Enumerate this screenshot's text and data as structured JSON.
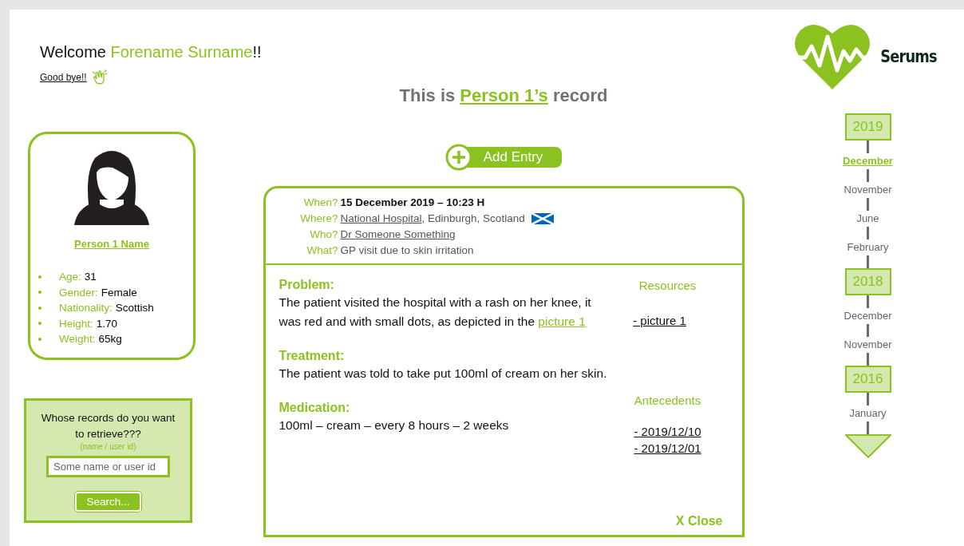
{
  "welcome": {
    "greeting": "Welcome ",
    "user_name": "Forename Surname",
    "suffix": "!!"
  },
  "logout": {
    "label": "Good bye!!"
  },
  "title": {
    "prefix": "This is ",
    "person_link": "Person 1’s",
    "suffix": " record"
  },
  "profile": {
    "name": "Person 1 Name",
    "attributes": [
      {
        "label": "Age:",
        "value": "31"
      },
      {
        "label": "Gender:",
        "value": "Female"
      },
      {
        "label": "Nationality:",
        "value": "Scottish"
      },
      {
        "label": "Height:",
        "value": "1.70"
      },
      {
        "label": "Weight:",
        "value": "65kg"
      }
    ]
  },
  "search": {
    "prompt": "Whose records do you want to retrieve???",
    "hint": "(name / user id)",
    "placeholder": "Some name or user id",
    "button": "Search..."
  },
  "add_entry": {
    "label": "Add Entry"
  },
  "record": {
    "details": [
      {
        "label": "When?",
        "kind": "bold",
        "segments": [
          {
            "text": "15 December 2019 – 10:23 H",
            "link": false
          }
        ]
      },
      {
        "label": "Where?",
        "kind": "flag",
        "segments": [
          {
            "text": "National Hospital",
            "link": true
          },
          {
            "text": ", Edinburgh, Scotland",
            "link": false
          }
        ]
      },
      {
        "label": "Who?",
        "kind": "plain",
        "segments": [
          {
            "text": "Dr Someone Something",
            "link": true
          }
        ]
      },
      {
        "label": "What?",
        "kind": "plain",
        "segments": [
          {
            "text": "GP visit due to skin irritation",
            "link": false
          }
        ]
      }
    ],
    "sections": [
      {
        "heading": "Problem:",
        "segments": [
          {
            "text": "The patient visited the hospital with a rash on her knee, it was red and with small dots, as depicted in the ",
            "link": false
          },
          {
            "text": "picture 1",
            "link": true
          }
        ]
      },
      {
        "heading": "Treatment:",
        "segments": [
          {
            "text": "The patient was told to take put 100ml of cream on her skin.",
            "link": false
          }
        ]
      },
      {
        "heading": "Medication:",
        "segments": [
          {
            "text": "100ml – cream – every 8 hours – 2 weeks",
            "link": false
          }
        ]
      }
    ],
    "resources": {
      "title": "Resources",
      "links": [
        "- picture 1"
      ]
    },
    "antecedents": {
      "title": "Antecedents",
      "links": [
        "- 2019/12/10",
        "- 2019/12/01"
      ]
    },
    "close": "X Close"
  },
  "brand": {
    "name": "Serums"
  },
  "timeline": [
    {
      "kind": "year",
      "label": "2019"
    },
    {
      "kind": "month",
      "label": "December",
      "selected": true
    },
    {
      "kind": "month",
      "label": "November",
      "selected": false
    },
    {
      "kind": "month",
      "label": "June",
      "selected": false
    },
    {
      "kind": "month",
      "label": "February",
      "selected": false
    },
    {
      "kind": "year",
      "label": "2018"
    },
    {
      "kind": "month",
      "label": "December",
      "selected": false
    },
    {
      "kind": "month",
      "label": "November",
      "selected": false
    },
    {
      "kind": "year",
      "label": "2016"
    },
    {
      "kind": "month",
      "label": "January",
      "selected": false
    },
    {
      "kind": "more"
    }
  ]
}
